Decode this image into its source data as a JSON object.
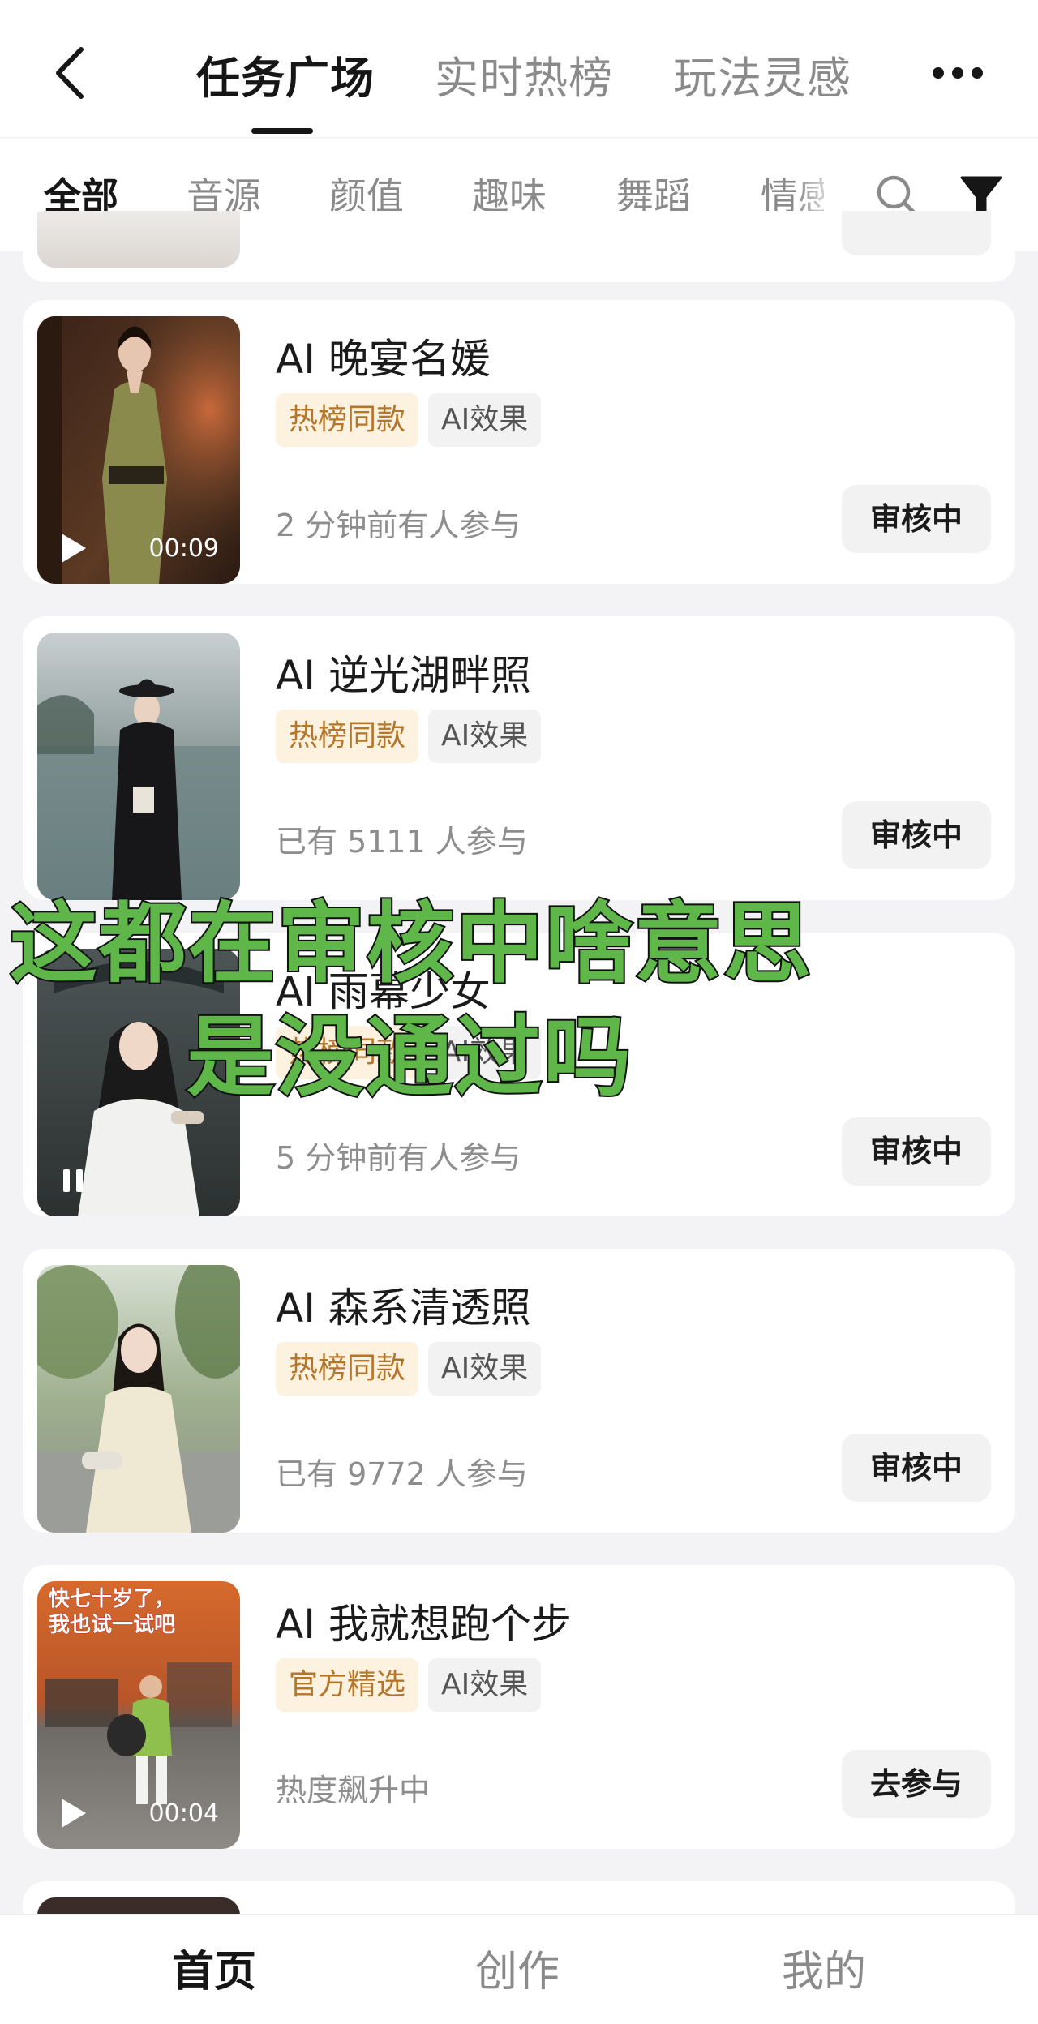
{
  "nav": {
    "tabs": [
      {
        "label": "任务广场",
        "active": true
      },
      {
        "label": "实时热榜",
        "active": false
      },
      {
        "label": "玩法灵感",
        "active": false
      }
    ]
  },
  "categories": [
    "全部",
    "音源",
    "颜值",
    "趣味",
    "舞蹈",
    "情感"
  ],
  "tasks": [
    {
      "title": "AI 晚宴名媛",
      "tags": [
        "热榜同款",
        "AI效果"
      ],
      "meta": "2 分钟前有人参与",
      "status": "审核中",
      "duration": "00:09",
      "play_state": "play"
    },
    {
      "title": "AI 逆光湖畔照",
      "tags": [
        "热榜同款",
        "AI效果"
      ],
      "meta": "已有 5111 人参与",
      "status": "审核中",
      "duration": "",
      "play_state": ""
    },
    {
      "title": "AI 雨幕少女",
      "tags": [
        "热榜同款",
        "AI效果"
      ],
      "meta": "5 分钟前有人参与",
      "status": "审核中",
      "duration": "",
      "play_state": "pause"
    },
    {
      "title": "AI 森系清透照",
      "tags": [
        "热榜同款",
        "AI效果"
      ],
      "meta": "已有 9772 人参与",
      "status": "审核中",
      "duration": "",
      "play_state": ""
    },
    {
      "title": "AI 我就想跑个步",
      "tags": [
        "官方精选",
        "AI效果"
      ],
      "meta": "热度飙升中",
      "status": "去参与",
      "duration": "00:04",
      "play_state": "play",
      "thumb_caption": [
        "快七十岁了，",
        "我也试一试吧"
      ]
    }
  ],
  "overlay": {
    "line1": "这都在审核中啥意思",
    "line2": "是没通过吗"
  },
  "tabbar": [
    {
      "label": "首页",
      "active": true
    },
    {
      "label": "创作",
      "active": false
    },
    {
      "label": "我的",
      "active": false
    }
  ],
  "colors": {
    "overlay_text": "#5fb74a",
    "hot_tag_bg": "#fdf1df",
    "hot_tag_text": "#b5762a",
    "page_bg": "#f3f3f5"
  }
}
